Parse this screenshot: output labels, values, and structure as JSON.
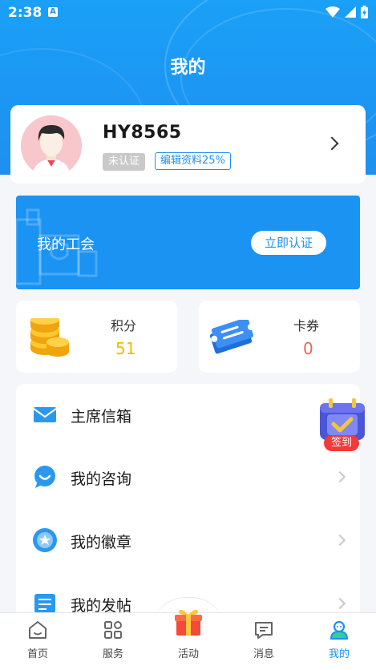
{
  "status_bar": {
    "time": "2:38",
    "notification_letter": "A"
  },
  "page": {
    "title": "我的"
  },
  "profile": {
    "username": "HY8565",
    "verification_badge": "未认证",
    "edit_badge": "编辑资料25%"
  },
  "union": {
    "title": "我的工会",
    "button_label": "立即认证"
  },
  "stats": {
    "points": {
      "label": "积分",
      "value": "51",
      "color": "#f5b800"
    },
    "coupons": {
      "label": "卡券",
      "value": "0",
      "color": "#f0645a"
    }
  },
  "menu": {
    "items": [
      {
        "label": "主席信箱",
        "icon": "mail-icon"
      },
      {
        "label": "我的咨询",
        "icon": "chat-bubble-icon"
      },
      {
        "label": "我的徽章",
        "icon": "medal-icon"
      },
      {
        "label": "我的发帖",
        "icon": "post-list-icon"
      }
    ]
  },
  "checkin": {
    "label": "签到"
  },
  "tabbar": {
    "items": [
      {
        "label": "首页",
        "icon": "home-icon"
      },
      {
        "label": "服务",
        "icon": "grid-services-icon"
      },
      {
        "label": "活动",
        "icon": "gift-icon"
      },
      {
        "label": "消息",
        "icon": "message-icon"
      },
      {
        "label": "我的",
        "icon": "user-icon",
        "active": true
      }
    ]
  },
  "colors": {
    "primary": "#1e90f0",
    "accent_red": "#f23a3a"
  }
}
